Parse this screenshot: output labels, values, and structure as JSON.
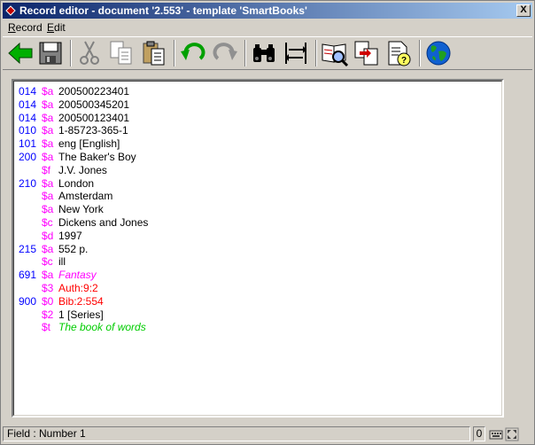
{
  "window": {
    "title": "Record editor - document '2.553' - template 'SmartBooks'",
    "close_label": "X"
  },
  "menu": {
    "items": [
      {
        "label": "Record",
        "accel": "R",
        "rest": "ecord"
      },
      {
        "label": "Edit",
        "accel": "E",
        "rest": "dit"
      }
    ]
  },
  "toolbar": {
    "buttons": [
      {
        "icon": "back-arrow-icon"
      },
      {
        "icon": "save-icon"
      },
      {
        "icon": "cut-icon"
      },
      {
        "icon": "copy-icon"
      },
      {
        "icon": "paste-icon"
      },
      {
        "icon": "undo-icon"
      },
      {
        "icon": "redo-icon"
      },
      {
        "icon": "find-icon"
      },
      {
        "icon": "swap-icon"
      },
      {
        "icon": "book-search-icon"
      },
      {
        "icon": "copy-record-icon"
      },
      {
        "icon": "document-help-icon"
      },
      {
        "icon": "globe-icon"
      }
    ]
  },
  "colors": {
    "tag": "#0000ff",
    "subfield": "#ff00ff",
    "value": "#000000",
    "italic_magenta": "#ff00ff",
    "auth_red": "#ff0000",
    "green": "#00cc00"
  },
  "record": {
    "lines": [
      {
        "tag": "014",
        "sub": "$a",
        "value": "200500223401",
        "color": "#000000",
        "italic": false
      },
      {
        "tag": "014",
        "sub": "$a",
        "value": "200500345201",
        "color": "#000000",
        "italic": false
      },
      {
        "tag": "014",
        "sub": "$a",
        "value": "200500123401",
        "color": "#000000",
        "italic": false
      },
      {
        "tag": "010",
        "sub": "$a",
        "value": "1-85723-365-1",
        "color": "#000000",
        "italic": false
      },
      {
        "tag": "101",
        "sub": "$a",
        "value": "eng [English]",
        "color": "#000000",
        "italic": false
      },
      {
        "tag": "200",
        "sub": "$a",
        "value": "The Baker's Boy",
        "color": "#000000",
        "italic": false
      },
      {
        "tag": "",
        "sub": "$f",
        "value": "J.V. Jones",
        "color": "#000000",
        "italic": false
      },
      {
        "tag": "210",
        "sub": "$a",
        "value": "London",
        "color": "#000000",
        "italic": false
      },
      {
        "tag": "",
        "sub": "$a",
        "value": "Amsterdam",
        "color": "#000000",
        "italic": false
      },
      {
        "tag": "",
        "sub": "$a",
        "value": "New York",
        "color": "#000000",
        "italic": false
      },
      {
        "tag": "",
        "sub": "$c",
        "value": "Dickens and Jones",
        "color": "#000000",
        "italic": false
      },
      {
        "tag": "",
        "sub": "$d",
        "value": "1997",
        "color": "#000000",
        "italic": false
      },
      {
        "tag": "215",
        "sub": "$a",
        "value": "552 p.",
        "color": "#000000",
        "italic": false
      },
      {
        "tag": "",
        "sub": "$c",
        "value": "ill",
        "color": "#000000",
        "italic": false
      },
      {
        "tag": "691",
        "sub": "$a",
        "value": "Fantasy",
        "color": "#ff00ff",
        "italic": true
      },
      {
        "tag": "",
        "sub": "$3",
        "value": "Auth:9:2",
        "color": "#ff0000",
        "italic": false
      },
      {
        "tag": "900",
        "sub": "$0",
        "value": "Bib:2:554",
        "color": "#ff0000",
        "italic": false
      },
      {
        "tag": "",
        "sub": "$2",
        "value": "1 [Series]",
        "color": "#000000",
        "italic": false
      },
      {
        "tag": "",
        "sub": "$t",
        "value": "The book of words",
        "color": "#00cc00",
        "italic": true
      }
    ]
  },
  "status": {
    "field": "Field : Number 1",
    "count": "0"
  }
}
